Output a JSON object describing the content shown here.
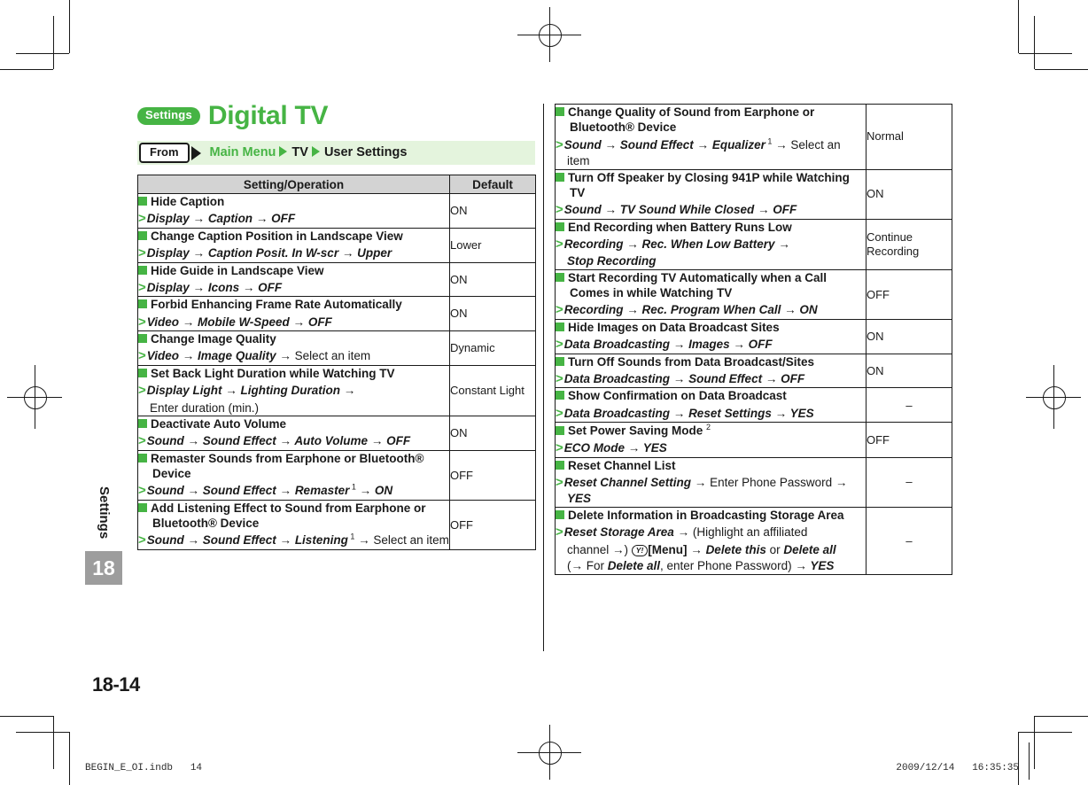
{
  "heading": {
    "badge": "Settings",
    "title": "Digital TV"
  },
  "frombar": {
    "key_label": "From",
    "crumb1": "Main Menu",
    "crumb2": "TV",
    "crumb3": "User Settings"
  },
  "sidebar": {
    "chapter_label": "Settings",
    "chapter_number": "18"
  },
  "table": {
    "header_operation": "Setting/Operation",
    "header_default": "Default"
  },
  "left_rows": [
    {
      "title": "Hide Caption",
      "steps": [
        [
          {
            "t": "Display",
            "s": "bi"
          },
          {
            "t": " → ",
            "s": "bi"
          },
          {
            "t": "Caption",
            "s": "bi"
          },
          {
            "t": " → ",
            "s": "bi"
          },
          {
            "t": "OFF",
            "s": "bi"
          }
        ]
      ],
      "default": "ON"
    },
    {
      "title": "Change Caption Position in Landscape View",
      "steps": [
        [
          {
            "t": "Display",
            "s": "bi"
          },
          {
            "t": " → ",
            "s": "bi"
          },
          {
            "t": "Caption Posit. In W-scr",
            "s": "bi"
          },
          {
            "t": " → ",
            "s": "bi"
          },
          {
            "t": "Upper",
            "s": "bi"
          }
        ]
      ],
      "default": "Lower"
    },
    {
      "title": "Hide Guide in Landscape View",
      "steps": [
        [
          {
            "t": "Display",
            "s": "bi"
          },
          {
            "t": " → ",
            "s": "bi"
          },
          {
            "t": "Icons",
            "s": "bi"
          },
          {
            "t": " → ",
            "s": "bi"
          },
          {
            "t": "OFF",
            "s": "bi"
          }
        ]
      ],
      "default": "ON"
    },
    {
      "title": "Forbid Enhancing Frame Rate Automatically",
      "steps": [
        [
          {
            "t": "Video",
            "s": "bi"
          },
          {
            "t": " → ",
            "s": "bi"
          },
          {
            "t": "Mobile W-Speed",
            "s": "bi"
          },
          {
            "t": " → ",
            "s": "bi"
          },
          {
            "t": "OFF",
            "s": "bi"
          }
        ]
      ],
      "default": "ON"
    },
    {
      "title": "Change Image Quality",
      "steps": [
        [
          {
            "t": "Video",
            "s": "bi"
          },
          {
            "t": " → ",
            "s": "bi"
          },
          {
            "t": "Image Quality",
            "s": "bi"
          },
          {
            "t": " → ",
            "s": "plain"
          },
          {
            "t": "Select an item",
            "s": "plain"
          }
        ]
      ],
      "default": "Dynamic"
    },
    {
      "title": "Set Back Light Duration while Watching TV",
      "steps": [
        [
          {
            "t": "Display Light",
            "s": "bi"
          },
          {
            "t": " → ",
            "s": "bi"
          },
          {
            "t": "Lighting Duration",
            "s": "bi"
          },
          {
            "t": " →",
            "s": "bi"
          }
        ],
        [
          {
            "t": "Enter duration (min.)",
            "s": "plain"
          }
        ]
      ],
      "default": "Constant Light"
    },
    {
      "title": "Deactivate Auto Volume",
      "steps": [
        [
          {
            "t": "Sound",
            "s": "bi"
          },
          {
            "t": " → ",
            "s": "bi"
          },
          {
            "t": "Sound Effect",
            "s": "bi"
          },
          {
            "t": " → ",
            "s": "bi"
          },
          {
            "t": "Auto Volume",
            "s": "bi"
          },
          {
            "t": " → ",
            "s": "bi"
          },
          {
            "t": "OFF",
            "s": "bi"
          }
        ]
      ],
      "default": "ON"
    },
    {
      "title": "Remaster Sounds from Earphone or Bluetooth® Device",
      "steps": [
        [
          {
            "t": "Sound",
            "s": "bi"
          },
          {
            "t": " → ",
            "s": "bi"
          },
          {
            "t": "Sound Effect",
            "s": "bi"
          },
          {
            "t": " → ",
            "s": "bi"
          },
          {
            "t": "Remaster",
            "s": "bi"
          },
          {
            "t": " 1",
            "s": "sup"
          },
          {
            "t": " → ",
            "s": "bi"
          },
          {
            "t": "ON",
            "s": "bi"
          }
        ]
      ],
      "default": "OFF"
    },
    {
      "title": "Add Listening Effect to Sound from Earphone or Bluetooth® Device",
      "steps": [
        [
          {
            "t": "Sound",
            "s": "bi"
          },
          {
            "t": " → ",
            "s": "bi"
          },
          {
            "t": "Sound Effect",
            "s": "bi"
          },
          {
            "t": " → ",
            "s": "bi"
          },
          {
            "t": "Listening",
            "s": "bi"
          },
          {
            "t": " 1",
            "s": "sup"
          },
          {
            "t": " → ",
            "s": "plain"
          },
          {
            "t": "Select an item",
            "s": "plain"
          }
        ]
      ],
      "default": "OFF"
    }
  ],
  "right_rows": [
    {
      "title": "Change Quality of Sound from Earphone or Bluetooth® Device",
      "steps": [
        [
          {
            "t": "Sound",
            "s": "bi"
          },
          {
            "t": " → ",
            "s": "bi"
          },
          {
            "t": "Sound Effect",
            "s": "bi"
          },
          {
            "t": " → ",
            "s": "bi"
          },
          {
            "t": "Equalizer",
            "s": "bi"
          },
          {
            "t": " 1",
            "s": "sup"
          },
          {
            "t": " → ",
            "s": "plain"
          },
          {
            "t": "Select an item",
            "s": "plain"
          }
        ]
      ],
      "default": "Normal"
    },
    {
      "title": "Turn Off Speaker by Closing 941P while Watching TV",
      "steps": [
        [
          {
            "t": "Sound",
            "s": "bi"
          },
          {
            "t": " → ",
            "s": "bi"
          },
          {
            "t": "TV Sound While Closed",
            "s": "bi"
          },
          {
            "t": " → ",
            "s": "bi"
          },
          {
            "t": "OFF",
            "s": "bi"
          }
        ]
      ],
      "default": "ON"
    },
    {
      "title": "End Recording when Battery Runs Low",
      "steps": [
        [
          {
            "t": "Recording",
            "s": "bi"
          },
          {
            "t": " → ",
            "s": "bi"
          },
          {
            "t": "Rec. When Low Battery",
            "s": "bi"
          },
          {
            "t": " →",
            "s": "bi"
          }
        ],
        [
          {
            "t": "Stop Recording",
            "s": "bi"
          }
        ]
      ],
      "default": "Continue Recording"
    },
    {
      "title": "Start Recording TV Automatically when a Call Comes in while Watching TV",
      "steps": [
        [
          {
            "t": "Recording",
            "s": "bi"
          },
          {
            "t": " → ",
            "s": "bi"
          },
          {
            "t": "Rec. Program When Call",
            "s": "bi"
          },
          {
            "t": " → ",
            "s": "bi"
          },
          {
            "t": "ON",
            "s": "bi"
          }
        ]
      ],
      "default": "OFF"
    },
    {
      "title": "Hide Images on Data Broadcast Sites",
      "steps": [
        [
          {
            "t": "Data Broadcasting",
            "s": "bi"
          },
          {
            "t": " → ",
            "s": "bi"
          },
          {
            "t": "Images",
            "s": "bi"
          },
          {
            "t": " → ",
            "s": "bi"
          },
          {
            "t": "OFF",
            "s": "bi"
          }
        ]
      ],
      "default": "ON"
    },
    {
      "title": "Turn Off Sounds from Data Broadcast/Sites",
      "steps": [
        [
          {
            "t": "Data Broadcasting",
            "s": "bi"
          },
          {
            "t": " → ",
            "s": "bi"
          },
          {
            "t": "Sound Effect",
            "s": "bi"
          },
          {
            "t": " → ",
            "s": "bi"
          },
          {
            "t": "OFF",
            "s": "bi"
          }
        ]
      ],
      "default": "ON"
    },
    {
      "title": "Show Confirmation on Data Broadcast",
      "steps": [
        [
          {
            "t": "Data Broadcasting",
            "s": "bi"
          },
          {
            "t": " → ",
            "s": "bi"
          },
          {
            "t": "Reset Settings",
            "s": "bi"
          },
          {
            "t": " → ",
            "s": "bi"
          },
          {
            "t": "YES",
            "s": "bi"
          }
        ]
      ],
      "default": "–"
    },
    {
      "title": "Set Power Saving Mode 2",
      "title_sup": "2",
      "steps": [
        [
          {
            "t": "ECO Mode",
            "s": "bi"
          },
          {
            "t": " → ",
            "s": "bi"
          },
          {
            "t": "YES",
            "s": "bi"
          }
        ]
      ],
      "default": "OFF"
    },
    {
      "title": "Reset Channel List",
      "steps": [
        [
          {
            "t": "Reset Channel Setting",
            "s": "bi"
          },
          {
            "t": " → ",
            "s": "plain"
          },
          {
            "t": "Enter Phone Password",
            "s": "plain"
          },
          {
            "t": " → ",
            "s": "bi"
          },
          {
            "t": "YES",
            "s": "bi"
          }
        ]
      ],
      "default": "–"
    },
    {
      "title": "Delete Information in Broadcasting Storage Area",
      "steps": [
        [
          {
            "t": "Reset Storage Area",
            "s": "bi"
          },
          {
            "t": " → ",
            "s": "plain"
          },
          {
            "t": "(Highlight an affiliated",
            "s": "plain"
          }
        ],
        [
          {
            "t": "channel →) ",
            "s": "plain"
          },
          {
            "t": "Y!",
            "s": "ykey"
          },
          {
            "t": "[Menu]",
            "s": "b"
          },
          {
            "t": " → ",
            "s": "plain"
          },
          {
            "t": "Delete this",
            "s": "bi"
          },
          {
            "t": " or ",
            "s": "plain"
          },
          {
            "t": "Delete all",
            "s": "bi"
          }
        ],
        [
          {
            "t": "(→ For ",
            "s": "plain"
          },
          {
            "t": "Delete all",
            "s": "bi"
          },
          {
            "t": ", enter Phone Password) ",
            "s": "plain"
          },
          {
            "t": "→ ",
            "s": "bi"
          },
          {
            "t": "YES",
            "s": "bi"
          }
        ]
      ],
      "default": "–"
    }
  ],
  "folio": "18-14",
  "footer": {
    "left": "BEGIN_E_OI.indb   14",
    "right": "2009/12/14   16:35:35"
  }
}
